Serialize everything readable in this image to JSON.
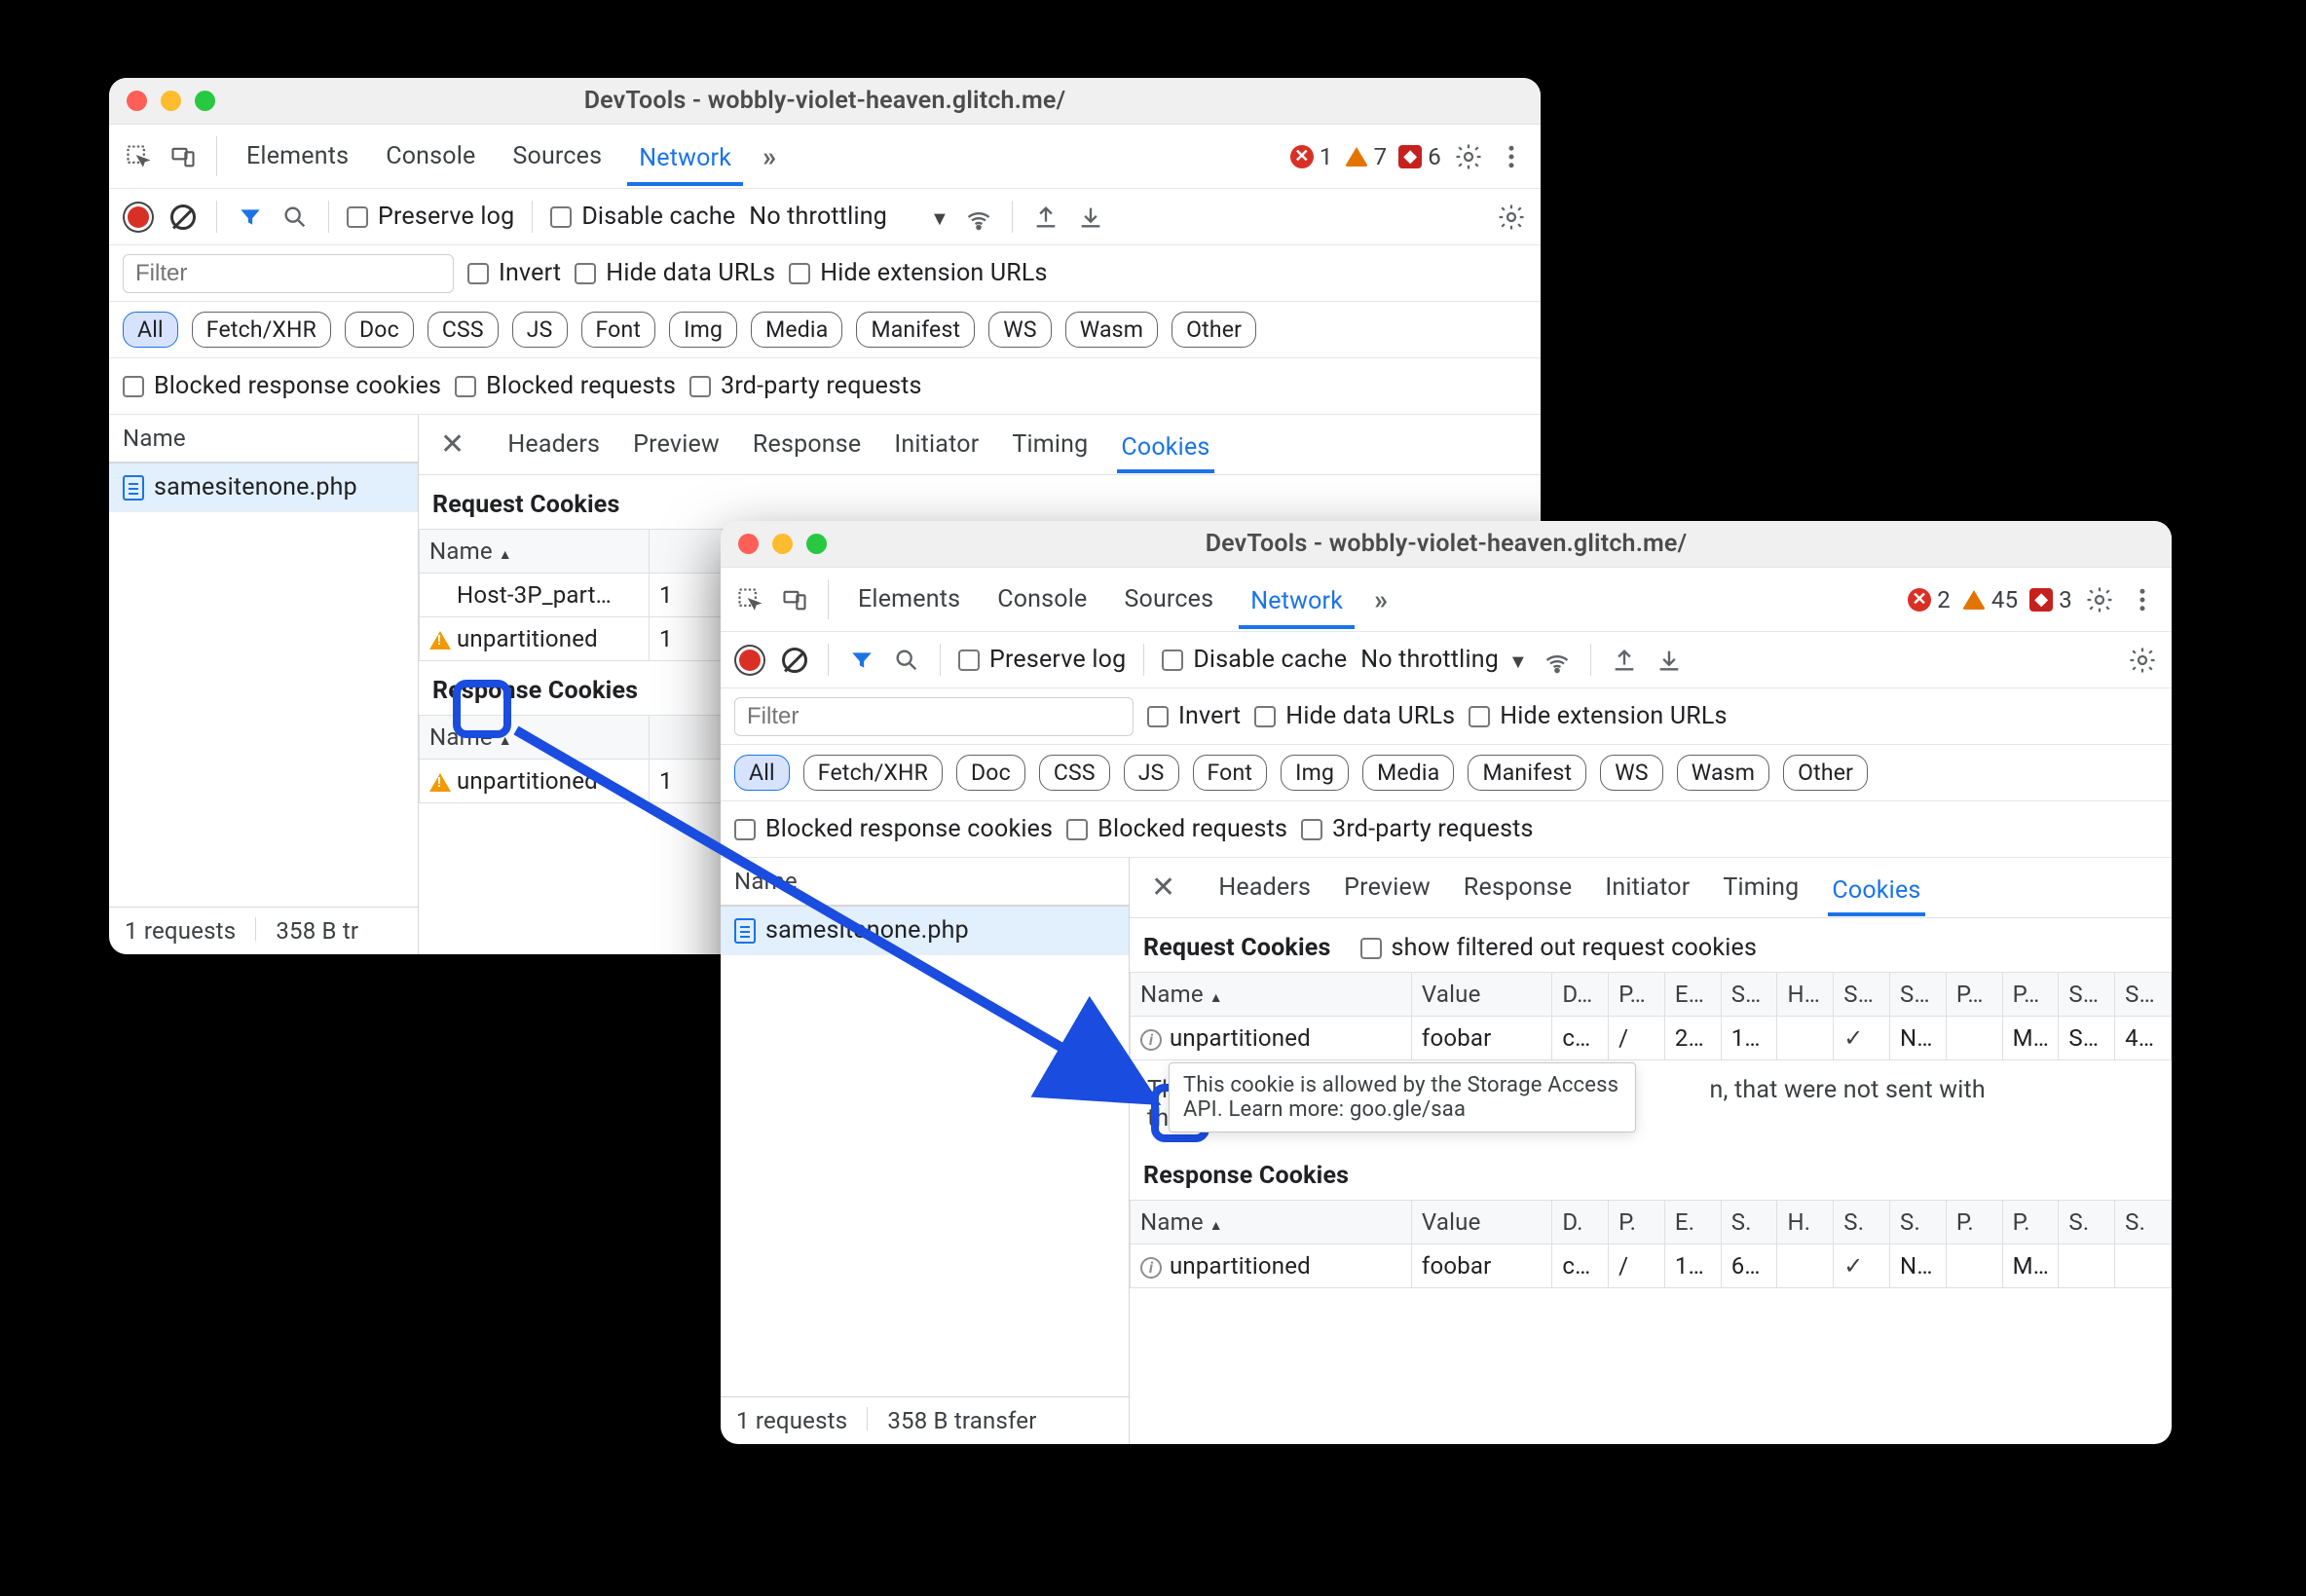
{
  "windows": {
    "a": {
      "title": "DevTools - wobbly-violet-heaven.glitch.me/",
      "main_tabs": [
        "Elements",
        "Console",
        "Sources",
        "Network"
      ],
      "active_main_tab": "Network",
      "badges": {
        "errors": 1,
        "warnings": 7,
        "issues": 6
      },
      "toolbar2": {
        "preserve_log": "Preserve log",
        "disable_cache": "Disable cache",
        "throttling": "No throttling"
      },
      "filter_placeholder": "Filter",
      "filter_checks": {
        "invert": "Invert",
        "hide_data": "Hide data URLs",
        "hide_ext": "Hide extension URLs"
      },
      "type_pills_active": "All",
      "type_pills": [
        "All",
        "Fetch/XHR",
        "Doc",
        "CSS",
        "JS",
        "Font",
        "Img",
        "Media",
        "Manifest",
        "WS",
        "Wasm",
        "Other"
      ],
      "extra_checks": {
        "blocked_resp": "Blocked response cookies",
        "blocked_req": "Blocked requests",
        "third_party": "3rd-party requests"
      },
      "request_list_header": "Name",
      "request_list": [
        "samesitenone.php"
      ],
      "detail_tabs": [
        "Headers",
        "Preview",
        "Response",
        "Initiator",
        "Timing",
        "Cookies"
      ],
      "active_detail_tab": "Cookies",
      "sections": {
        "request": "Request Cookies",
        "response": "Response Cookies"
      },
      "request_cookies_header": "Name",
      "request_cookies": [
        {
          "icon": "",
          "name": "Host-3P_part…",
          "v": "1"
        },
        {
          "icon": "warn",
          "name": "unpartitioned",
          "v": "1"
        }
      ],
      "response_cookies_header": "Name",
      "response_cookies": [
        {
          "icon": "warn",
          "name": "unpartitioned",
          "v": "1"
        }
      ],
      "status_bar": {
        "requests": "1 requests",
        "transfer": "358 B tr"
      }
    },
    "b": {
      "title": "DevTools - wobbly-violet-heaven.glitch.me/",
      "main_tabs": [
        "Elements",
        "Console",
        "Sources",
        "Network"
      ],
      "active_main_tab": "Network",
      "badges": {
        "errors": 2,
        "warnings": 45,
        "issues": 3
      },
      "toolbar2": {
        "preserve_log": "Preserve log",
        "disable_cache": "Disable cache",
        "throttling": "No throttling"
      },
      "filter_placeholder": "Filter",
      "filter_checks": {
        "invert": "Invert",
        "hide_data": "Hide data URLs",
        "hide_ext": "Hide extension URLs"
      },
      "type_pills_active": "All",
      "type_pills": [
        "All",
        "Fetch/XHR",
        "Doc",
        "CSS",
        "JS",
        "Font",
        "Img",
        "Media",
        "Manifest",
        "WS",
        "Wasm",
        "Other"
      ],
      "extra_checks": {
        "blocked_resp": "Blocked response cookies",
        "blocked_req": "Blocked requests",
        "third_party": "3rd-party requests"
      },
      "request_list_header": "Name",
      "request_list": [
        "samesitenone.php"
      ],
      "detail_tabs": [
        "Headers",
        "Preview",
        "Response",
        "Initiator",
        "Timing",
        "Cookies"
      ],
      "active_detail_tab": "Cookies",
      "sections": {
        "request": "Request Cookies",
        "show_filtered": "show filtered out request cookies",
        "response": "Response Cookies"
      },
      "columns": [
        "Name",
        "Value",
        "D…",
        "P…",
        "E…",
        "S…",
        "H…",
        "S…",
        "S…",
        "P…",
        "P…",
        "S…",
        "S…"
      ],
      "request_cookies": [
        {
          "icon": "info",
          "name": "unpartitioned",
          "value": "foobar",
          "d": "c…",
          "p": "/",
          "e": "2…",
          "s": "1…",
          "h": "",
          "ss": "✓",
          "sp": "N…",
          "p1": "",
          "p2": "M…",
          "s1": "S…",
          "s2": "4…"
        }
      ],
      "response_columns": [
        "Name",
        "Value",
        "D.",
        "P.",
        "E.",
        "S.",
        "H.",
        "S.",
        "S.",
        "P.",
        "P.",
        "S.",
        "S."
      ],
      "response_cookies": [
        {
          "icon": "info",
          "name": "unpartitioned",
          "value": "foobar",
          "d": "c…",
          "p": "/",
          "e": "1…",
          "s": "6…",
          "h": "",
          "ss": "✓",
          "sp": "N…",
          "p1": "",
          "p2": "M…",
          "s1": "",
          "s2": ""
        }
      ],
      "tooltip": "This cookie is allowed by the Storage Access API. Learn more: goo.gle/saa",
      "note_prefix": "Thi",
      "note_suffix": "n, that were not sent with this request. ",
      "learn_more": "Learn more",
      "status_bar": {
        "requests": "1 requests",
        "transfer": "358 B transfer"
      }
    }
  }
}
